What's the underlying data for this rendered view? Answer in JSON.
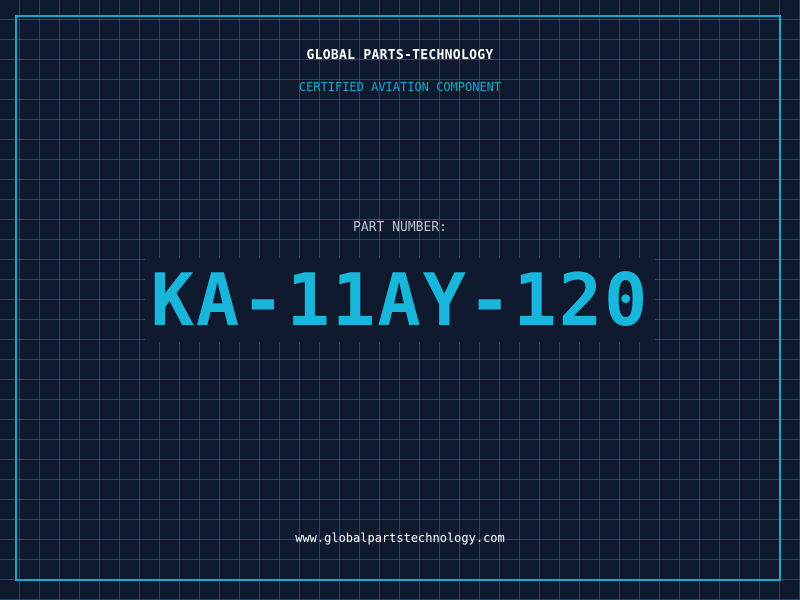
{
  "header": {
    "brand": "GLOBAL PARTS-TECHNOLOGY",
    "tagline": "CERTIFIED AVIATION COMPONENT"
  },
  "part": {
    "label": "PART NUMBER:",
    "number": "KA-11AY-120"
  },
  "footer": {
    "website": "www.globalpartstechnology.com"
  },
  "colors": {
    "background": "#0f1a2e",
    "accent": "#19a9cf",
    "grid": "#23789a",
    "text_primary": "#ffffff",
    "text_secondary": "#b8c2cf"
  }
}
